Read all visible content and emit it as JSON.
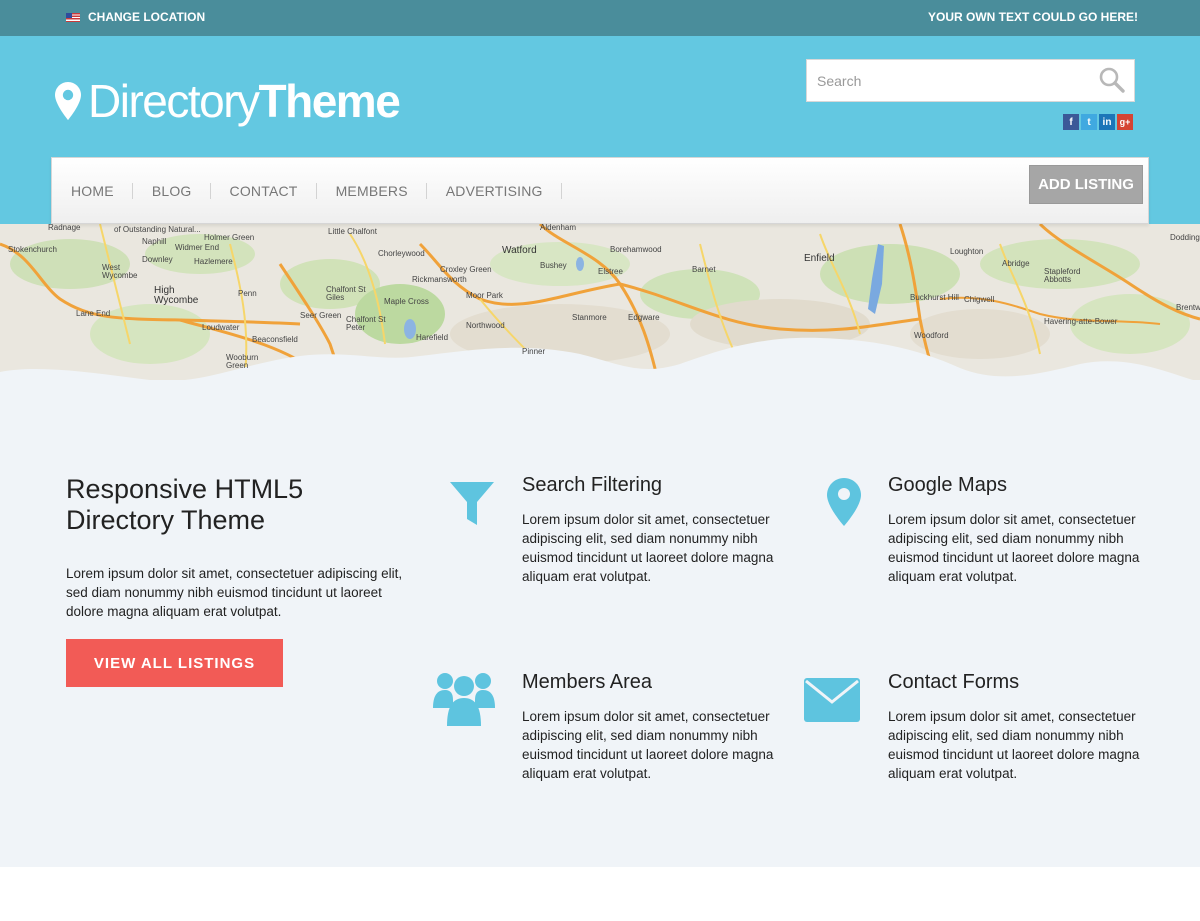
{
  "topbar": {
    "location_label": "CHANGE LOCATION",
    "tagline": "YOUR OWN TEXT COULD GO HERE!"
  },
  "header": {
    "logo_light": "Directory",
    "logo_bold": "Theme",
    "search_placeholder": "Search",
    "social": [
      "f",
      "t",
      "in",
      "g+"
    ]
  },
  "nav": {
    "items": [
      "HOME",
      "BLOG",
      "CONTACT",
      "MEMBERS",
      "ADVERTISING"
    ],
    "add_listing": "ADD LISTING"
  },
  "map": {
    "labels": [
      "Radnage",
      "of Outstanding Natural...",
      "Holmer Green",
      "Naphill",
      "Widmer End",
      "Stokenchurch",
      "Downley",
      "Hazlemere",
      "West Wycombe",
      "High Wycombe",
      "Lane End",
      "Loudwater",
      "Penn",
      "Chalfont St Giles",
      "Chalfont St Peter",
      "Seer Green",
      "Beaconsfield",
      "Wooburn Green",
      "Little Chalfont",
      "Chorleywood",
      "Rickmansworth",
      "Croxley Green",
      "Maple Cross",
      "Moor Park",
      "Harefield",
      "Northwood",
      "Pinner",
      "Watford",
      "Bushey",
      "Elstree",
      "Borehamwood",
      "Stanmore",
      "Edgware",
      "Barnet",
      "Aldenham",
      "Enfield",
      "Loughton",
      "Abridge",
      "Stapleford Abbotts",
      "Buckhurst Hill",
      "Chigwell",
      "Woodford",
      "Havering-atte-Bower",
      "Brentw",
      "Dodding"
    ]
  },
  "intro": {
    "title": "Responsive HTML5 Directory Theme",
    "text": "Lorem ipsum dolor sit amet, consectetuer adipiscing elit, sed diam nonummy nibh euismod tincidunt ut laoreet dolore magna aliquam erat volutpat.",
    "button": "VIEW ALL LISTINGS"
  },
  "features": [
    {
      "title": "Search Filtering",
      "text": "Lorem ipsum dolor sit amet, consectetuer adipiscing elit, sed diam nonummy nibh euismod tincidunt ut laoreet dolore magna aliquam erat volutpat.",
      "icon": "filter-icon"
    },
    {
      "title": "Google Maps",
      "text": "Lorem ipsum dolor sit amet, consectetuer adipiscing elit, sed diam nonummy nibh euismod tincidunt ut laoreet dolore magna aliquam erat volutpat.",
      "icon": "map-pin-icon"
    },
    {
      "title": "Members Area",
      "text": "Lorem ipsum dolor sit amet, consectetuer adipiscing elit, sed diam nonummy nibh euismod tincidunt ut laoreet dolore magna aliquam erat volutpat.",
      "icon": "users-icon"
    },
    {
      "title": "Contact Forms",
      "text": "Lorem ipsum dolor sit amet, consectetuer adipiscing elit, sed diam nonummy nibh euismod tincidunt ut laoreet dolore magna aliquam erat volutpat.",
      "icon": "envelope-icon"
    }
  ],
  "colors": {
    "topbar": "#4a8d9b",
    "header": "#63c8e1",
    "accent_icon": "#5ec4df",
    "cta": "#f25b56",
    "section_bg": "#f0f4f8"
  }
}
